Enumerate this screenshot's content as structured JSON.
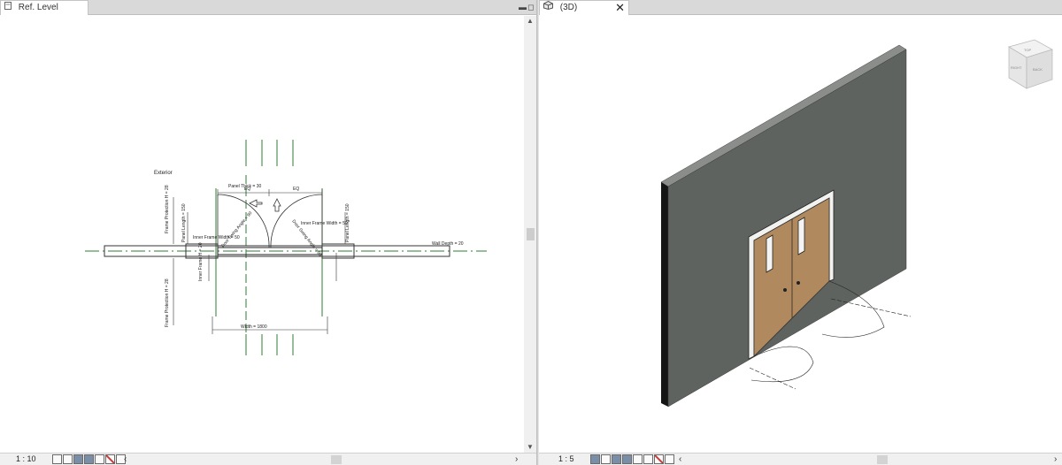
{
  "left_view": {
    "tab_label": "Ref. Level",
    "scale": "1 : 10",
    "drawing_labels": {
      "exterior": "Exterior",
      "dim_top_left": "EQ",
      "dim_top_right": "EQ",
      "panel_thick": "Panel Thick = 30",
      "frame_protection_top": "Frame Protection H = 28",
      "frame_protection_bottom": "Frame Protection H = 28",
      "panel_length_left": "Panel Length = 150",
      "panel_length_right": "Panel Length = 150",
      "inner_frame_width_left": "Inner Frame Width = 50",
      "inner_frame_width_right": "Inner Frame Width = 50",
      "inner_frame_h": "Inner Frame H = 20",
      "swing_angle_left": "Door Swing Angle = 90",
      "swing_angle_right": "Door Swing Angle = 90",
      "wall_depth": "Wall Depth = 20",
      "width": "Width = 1800"
    }
  },
  "right_view": {
    "tab_label": "(3D)",
    "close_symbol": "✕",
    "scale": "1 : 5",
    "viewcube": {
      "face_top": "TOP",
      "face_right": "RIGHT",
      "face_back": "BACK"
    }
  },
  "colors": {
    "wall_front": "#5f6360",
    "wall_top": "#8a8d8a",
    "wall_side": "#151515",
    "door_panel": "#b08a5e",
    "frame": "#f2f2f0",
    "reference_green": "#2e7d32"
  },
  "icons": {
    "tab_3d_icon": "3d-house-icon",
    "minimize": "minimize-icon",
    "scroll_left": "chevron-left-icon",
    "scroll_right": "chevron-right-icon"
  }
}
